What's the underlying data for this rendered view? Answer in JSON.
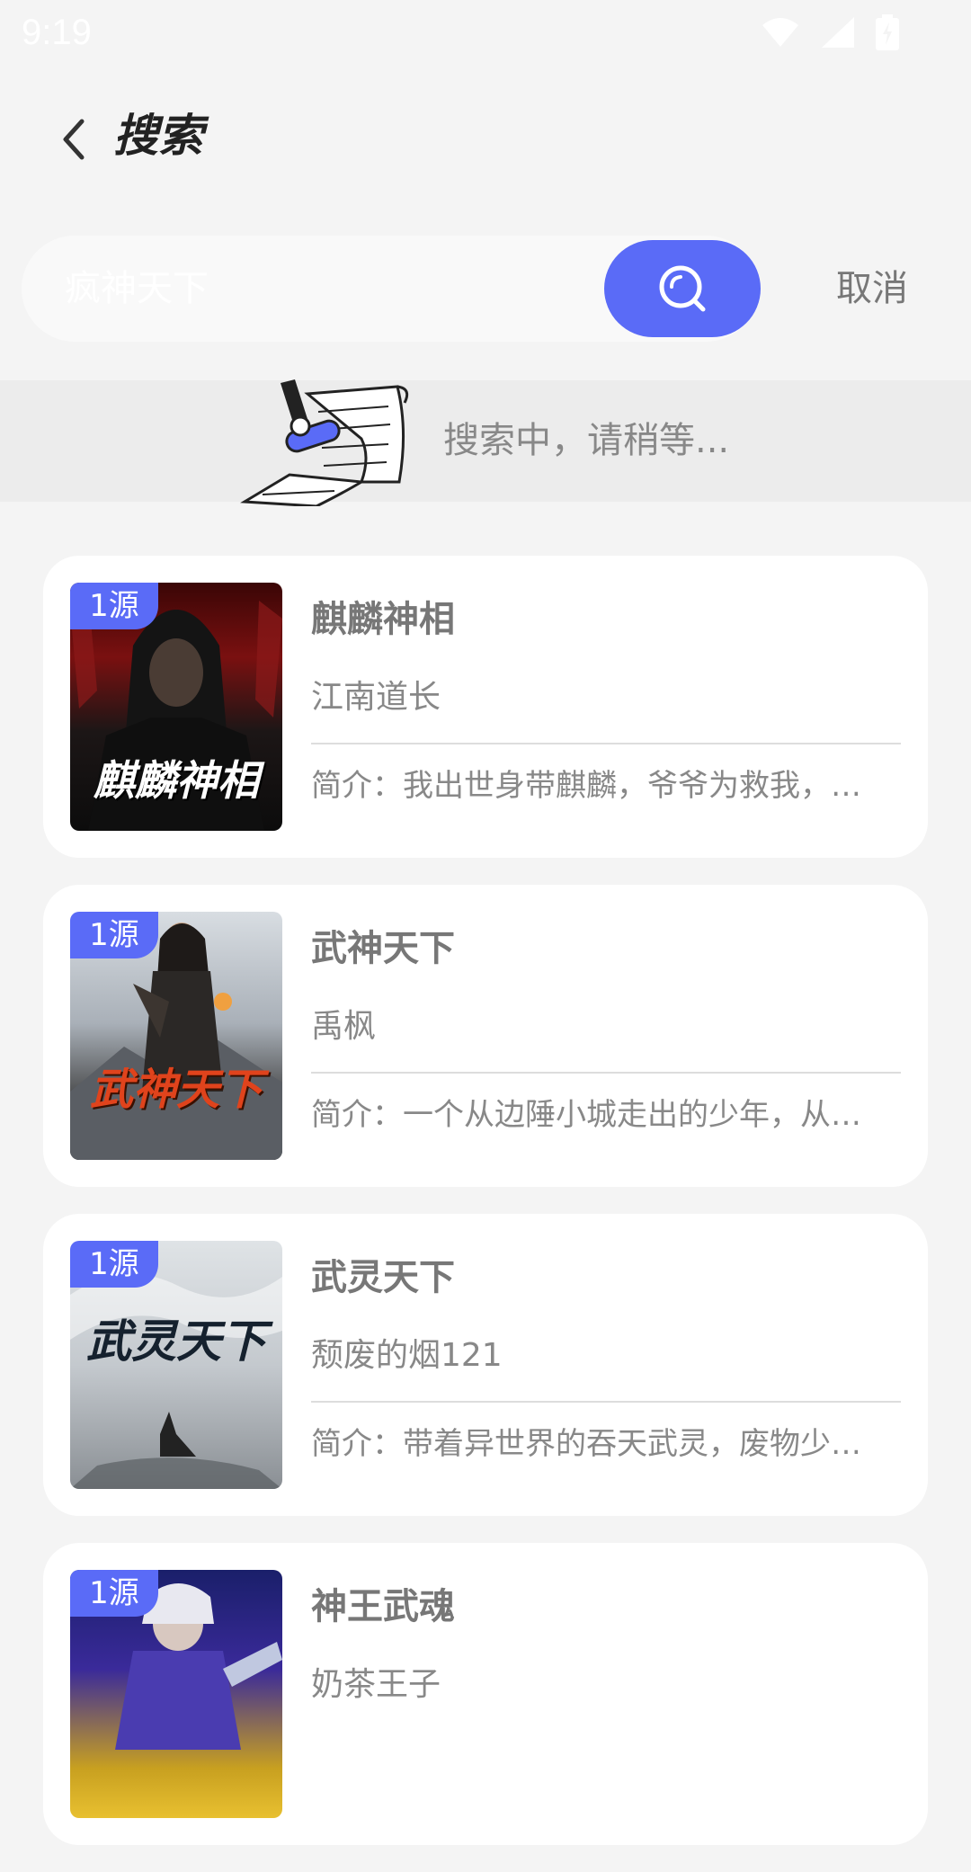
{
  "status_bar": {
    "time": "9:19"
  },
  "header": {
    "title": "搜索"
  },
  "search": {
    "value": "疯神天下",
    "cancel_label": "取消"
  },
  "loading": {
    "text": "搜索中，请稍等..."
  },
  "results": [
    {
      "badge": "1源",
      "title": "麒麟神相",
      "author": "江南道长",
      "intro": "简介：我出世身带麒麟，爷爷为救我，…",
      "cover_text": "麒麟神相"
    },
    {
      "badge": "1源",
      "title": "武神天下",
      "author": "禹枫",
      "intro": "简介：一个从边陲小城走出的少年，从…",
      "cover_text": "武神天下"
    },
    {
      "badge": "1源",
      "title": "武灵天下",
      "author": "颓废的烟121",
      "intro": "简介：带着异世界的吞天武灵，废物少…",
      "cover_text": "武灵天下"
    },
    {
      "badge": "1源",
      "title": "神王武魂",
      "author": "奶茶王子",
      "intro": "",
      "cover_text": ""
    }
  ]
}
